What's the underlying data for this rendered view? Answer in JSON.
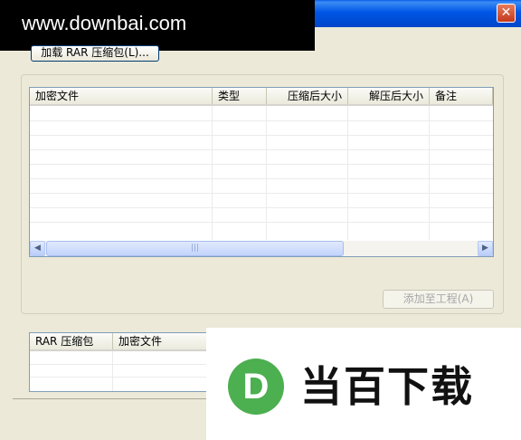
{
  "window": {
    "close_glyph": "✕"
  },
  "watermark": {
    "site": "www.downbai.com",
    "logo_letter": "D",
    "logo_text": "当百下载"
  },
  "toolbar": {
    "load_label": "加载 RAR 压缩包(L)..."
  },
  "file_list": {
    "columns": [
      "加密文件",
      "类型",
      "压缩后大小",
      "解压后大小",
      "备注"
    ],
    "rows": []
  },
  "hscroll": {
    "left_glyph": "◀",
    "right_glyph": "▶",
    "grip": "|||"
  },
  "actions": {
    "add_to_project_label": "添加至工程(A)"
  },
  "archive_list": {
    "columns": [
      "RAR 压缩包",
      "加密文件"
    ],
    "rows": []
  }
}
